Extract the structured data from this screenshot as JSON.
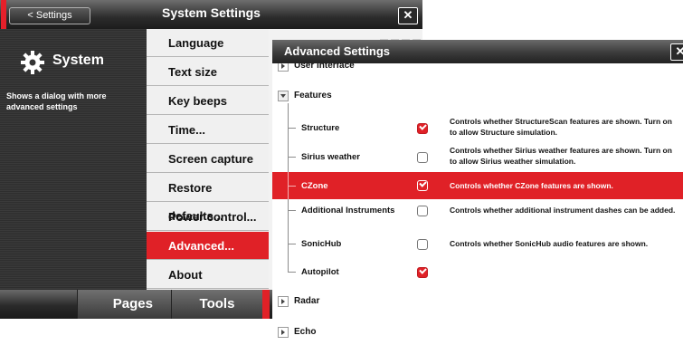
{
  "system_window": {
    "back_label": "< Settings",
    "title": "System Settings",
    "close_glyph": "✕",
    "heading": "System",
    "description": "Shows a dialog with more advanced settings",
    "menu": [
      {
        "label": "Language",
        "active": false
      },
      {
        "label": "Text size",
        "active": false
      },
      {
        "label": "Key beeps",
        "active": false
      },
      {
        "label": "Time...",
        "active": false
      },
      {
        "label": "Screen capture",
        "active": false
      },
      {
        "label": "Restore defaults...",
        "active": false
      },
      {
        "label": "Power control...",
        "active": false
      },
      {
        "label": "Advanced...",
        "active": true
      },
      {
        "label": "About",
        "active": false
      }
    ],
    "bottom_tabs": {
      "pages": "Pages",
      "tools": "Tools"
    },
    "accent_color": "#e02127"
  },
  "advanced_dialog": {
    "title": "Advanced Settings",
    "close_glyph": "✕",
    "groups": {
      "user_interface": {
        "label": "User interface",
        "expanded": false
      },
      "features": {
        "label": "Features",
        "expanded": true
      },
      "radar": {
        "label": "Radar",
        "expanded": false
      },
      "echo": {
        "label": "Echo",
        "expanded": false
      }
    },
    "features": [
      {
        "label": "Structure",
        "checked": true,
        "selected": false,
        "description": "Controls whether StructureScan features are shown. Turn on to allow Structure simulation."
      },
      {
        "label": "Sirius weather",
        "checked": false,
        "selected": false,
        "description": "Controls whether Sirius weather features are shown. Turn on to allow Sirius weather simulation."
      },
      {
        "label": "CZone",
        "checked": true,
        "selected": true,
        "description": "Controls whether CZone features are shown."
      },
      {
        "label": "Additional Instruments",
        "checked": false,
        "selected": false,
        "description": "Controls whether additional instrument dashes can be added."
      },
      {
        "label": "SonicHub",
        "checked": false,
        "selected": false,
        "description": "Controls whether SonicHub audio features are shown."
      },
      {
        "label": "Autopilot",
        "checked": true,
        "selected": false,
        "description": ""
      }
    ]
  },
  "icons": {
    "gear": "gear-icon",
    "expand": "triangle-right-icon",
    "collapse": "triangle-down-icon",
    "checkbox": "checkmark-icon"
  }
}
